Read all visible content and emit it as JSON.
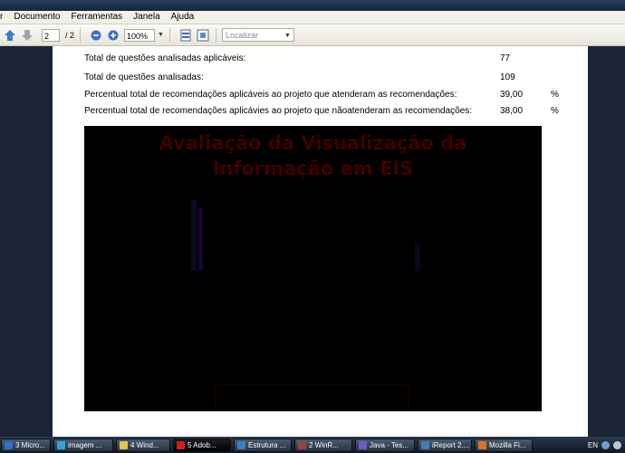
{
  "menu": [
    "r",
    "Documento",
    "Ferramentas",
    "Janela",
    "Ajuda"
  ],
  "toolbar": {
    "page_current": "2",
    "page_total": "/ 2",
    "zoom": "100%",
    "search_placeholder": "Localizar"
  },
  "stats": [
    {
      "label": "Total de questões analisadas aplicáveis:",
      "value": "77",
      "unit": ""
    },
    {
      "label": "Total de questões analisadas:",
      "value": "109",
      "unit": ""
    },
    {
      "label": "Percentual total de recomendações aplicáveis ao projeto que atenderam as recomendações:",
      "value": "39,00",
      "unit": "%"
    },
    {
      "label": "Percentual total de recomendações aplicávies ao projeto que nãoatenderam as recomendações:",
      "value": "38,00",
      "unit": "%"
    }
  ],
  "chart": {
    "title_line1": "Avaliação da Visualização da",
    "title_line2": "Informação em EIS",
    "background": "#000000",
    "title_color": "#3d0000"
  },
  "taskbar": {
    "items": [
      {
        "label": "3 Micro...",
        "color": "#2e6fd0"
      },
      {
        "label": "imagem ...",
        "color": "#3aa0e0"
      },
      {
        "label": "4 Wind...",
        "color": "#e8c050"
      },
      {
        "label": "5 Adob...",
        "color": "#d02020"
      },
      {
        "label": "Estrutura ...",
        "color": "#3a80c0"
      },
      {
        "label": "2 WinR...",
        "color": "#a04040"
      },
      {
        "label": "Java - Tes...",
        "color": "#6a5acd"
      },
      {
        "label": "iReport 2....",
        "color": "#4a7ab0"
      },
      {
        "label": "Mozilla Fi...",
        "color": "#e07020"
      }
    ],
    "language": "EN"
  }
}
